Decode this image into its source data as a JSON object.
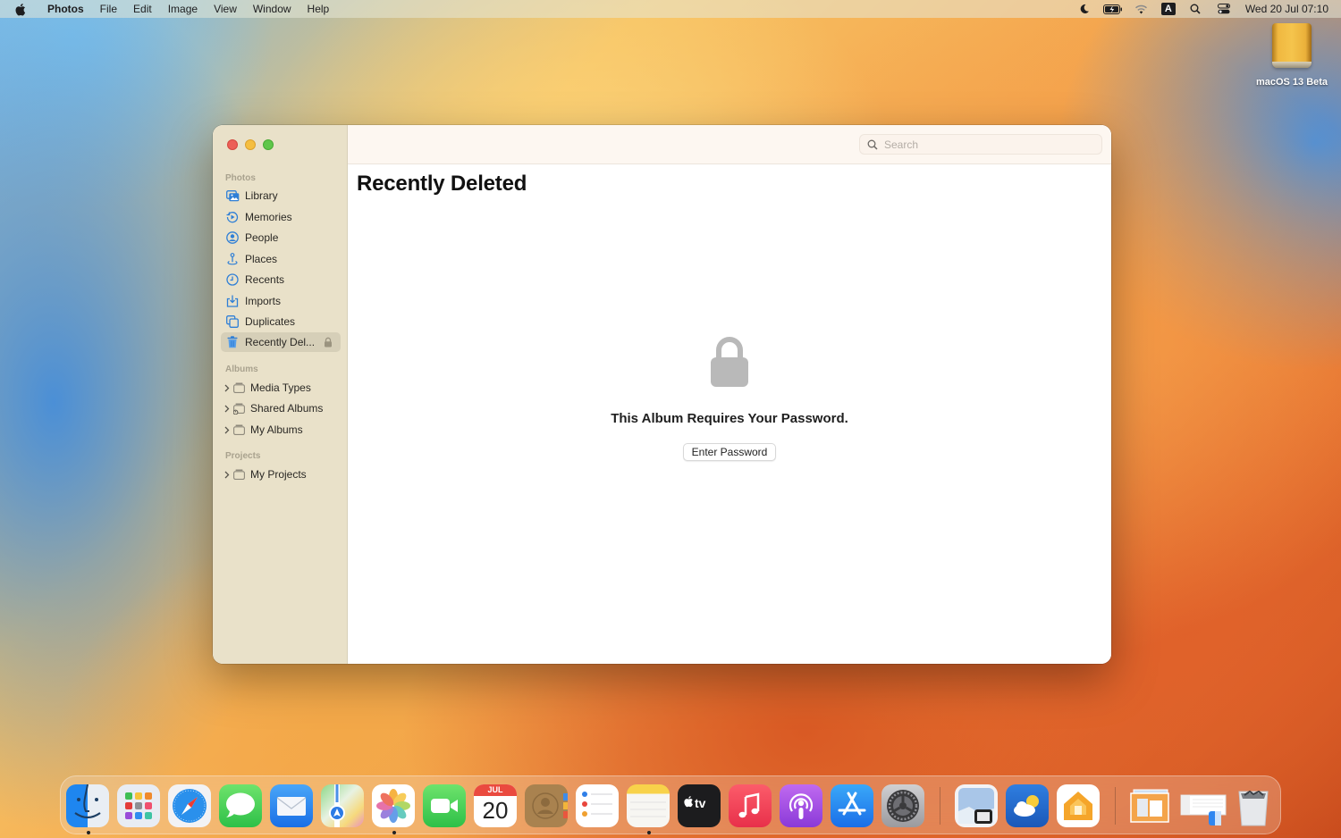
{
  "menubar": {
    "app_name": "Photos",
    "menus": [
      "File",
      "Edit",
      "Image",
      "View",
      "Window",
      "Help"
    ],
    "status_icons": [
      "focus-moon-icon",
      "battery-charging-icon",
      "wifi-icon",
      "input-source-icon",
      "spotlight-search-icon",
      "control-center-icon"
    ],
    "input_source_label": "A",
    "clock": "Wed 20 Jul  07:10"
  },
  "desktop": {
    "icons": [
      {
        "label": "macOS 13 Beta",
        "icon": "external-drive-icon"
      }
    ]
  },
  "window": {
    "sidebar": {
      "sections": [
        {
          "header": "Photos",
          "items": [
            {
              "label": "Library",
              "icon": "library-icon"
            },
            {
              "label": "Memories",
              "icon": "memories-icon"
            },
            {
              "label": "People",
              "icon": "people-icon"
            },
            {
              "label": "Places",
              "icon": "places-icon"
            },
            {
              "label": "Recents",
              "icon": "recents-icon"
            },
            {
              "label": "Imports",
              "icon": "imports-icon"
            },
            {
              "label": "Duplicates",
              "icon": "duplicates-icon"
            },
            {
              "label": "Recently Del...",
              "icon": "trash-icon",
              "selected": true,
              "locked": true
            }
          ]
        },
        {
          "header": "Albums",
          "items": [
            {
              "label": "Media Types",
              "icon": "folder-icon"
            },
            {
              "label": "Shared Albums",
              "icon": "shared-folder-icon"
            },
            {
              "label": "My Albums",
              "icon": "folder-icon"
            }
          ]
        },
        {
          "header": "Projects",
          "items": [
            {
              "label": "My Projects",
              "icon": "folder-icon"
            }
          ]
        }
      ]
    },
    "search": {
      "placeholder": "Search",
      "value": ""
    },
    "title": "Recently Deleted",
    "locked_message": "This Album Requires Your Password.",
    "enter_password_label": "Enter Password"
  },
  "dock": {
    "apps": [
      {
        "name": "Finder",
        "running": true
      },
      {
        "name": "Launchpad",
        "running": false
      },
      {
        "name": "Safari",
        "running": false
      },
      {
        "name": "Messages",
        "running": false
      },
      {
        "name": "Mail",
        "running": false
      },
      {
        "name": "Maps",
        "running": false
      },
      {
        "name": "Photos",
        "running": true
      },
      {
        "name": "FaceTime",
        "running": false
      },
      {
        "name": "Calendar",
        "running": false,
        "month": "JUL",
        "day": "20"
      },
      {
        "name": "Contacts",
        "running": false
      },
      {
        "name": "Reminders",
        "running": false
      },
      {
        "name": "Notes",
        "running": true
      },
      {
        "name": "TV",
        "running": false
      },
      {
        "name": "Music",
        "running": false
      },
      {
        "name": "Podcasts",
        "running": false
      },
      {
        "name": "App Store",
        "running": false
      },
      {
        "name": "System Settings",
        "running": false
      },
      {
        "name": "Preview",
        "running": false
      },
      {
        "name": "Weather",
        "running": false
      },
      {
        "name": "Home",
        "running": false
      },
      {
        "name": "Desktop Folder",
        "running": false
      },
      {
        "name": "Finder Window",
        "running": false
      },
      {
        "name": "Trash",
        "running": false
      }
    ]
  }
}
